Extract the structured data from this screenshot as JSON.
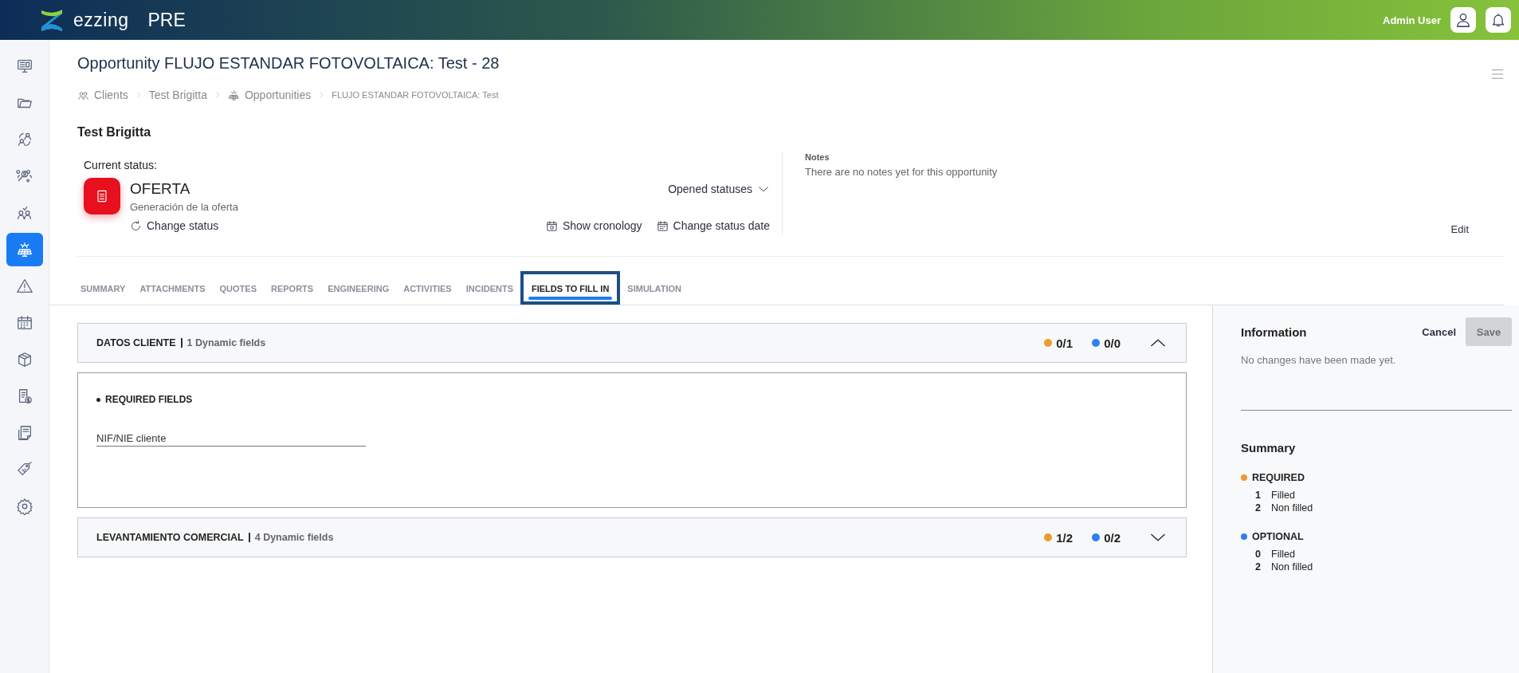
{
  "header": {
    "brand": "ezzing",
    "environment": "PRE",
    "user": "Admin User"
  },
  "sidebar": {
    "items": [
      {
        "selected": false
      },
      {
        "selected": false
      },
      {
        "selected": false
      },
      {
        "selected": false
      },
      {
        "selected": false
      },
      {
        "selected": true
      },
      {
        "selected": false
      },
      {
        "selected": false
      },
      {
        "selected": false
      },
      {
        "selected": false
      },
      {
        "selected": false
      },
      {
        "selected": false
      },
      {
        "selected": false
      }
    ]
  },
  "page": {
    "title": "Opportunity FLUJO ESTANDAR FOTOVOLTAICA: Test - 28",
    "breadcrumbs": [
      {
        "label": "Clients",
        "current": false
      },
      {
        "label": "Test Brigitta",
        "current": false
      },
      {
        "label": "Opportunities",
        "current": false
      },
      {
        "label": "FLUJO ESTANDAR FOTOVOLTAICA: Test",
        "current": true
      }
    ],
    "client": "Test Brigitta"
  },
  "status": {
    "label": "Current status:",
    "name": "OFERTA",
    "description": "Generación de la oferta",
    "opened_statuses": "Opened statuses",
    "change_status": "Change status",
    "show_cronology": "Show cronology",
    "change_status_date": "Change status date"
  },
  "notes": {
    "label": "Notes",
    "text": "There are no notes yet for this opportunity",
    "edit": "Edit"
  },
  "tabs": [
    {
      "label": "SUMMARY",
      "selected": false
    },
    {
      "label": "ATTACHMENTS",
      "selected": false
    },
    {
      "label": "QUOTES",
      "selected": false
    },
    {
      "label": "REPORTS",
      "selected": false
    },
    {
      "label": "ENGINEERING",
      "selected": false
    },
    {
      "label": "ACTIVITIES",
      "selected": false
    },
    {
      "label": "INCIDENTS",
      "selected": false
    },
    {
      "label": "FIELDS TO FILL IN",
      "selected": true
    },
    {
      "label": "SIMULATION",
      "selected": false
    }
  ],
  "sections": [
    {
      "title": "DATOS CLIENTE",
      "fields_count": "1 Dynamic fields",
      "required": "0/1",
      "optional": "0/0",
      "expanded": true,
      "group": "REQUIRED FIELDS",
      "fields": [
        {
          "placeholder": "NIF/NIE cliente"
        }
      ]
    },
    {
      "title": "LEVANTAMIENTO COMERCIAL",
      "fields_count": "4 Dynamic fields",
      "required": "1/2",
      "optional": "0/2",
      "expanded": false
    }
  ],
  "info_panel": {
    "title": "Information",
    "cancel": "Cancel",
    "save": "Save",
    "save_disabled": true,
    "message": "No changes have been made yet.",
    "summary_title": "Summary",
    "groups": [
      {
        "label": "REQUIRED",
        "color": "#eb9b2f",
        "rows": [
          {
            "count": "1",
            "label": "Filled"
          },
          {
            "count": "2",
            "label": "Non filled"
          }
        ]
      },
      {
        "label": "OPTIONAL",
        "color": "#2f7ff0",
        "rows": [
          {
            "count": "0",
            "label": "Filled"
          },
          {
            "count": "2",
            "label": "Non filled"
          }
        ]
      }
    ]
  }
}
